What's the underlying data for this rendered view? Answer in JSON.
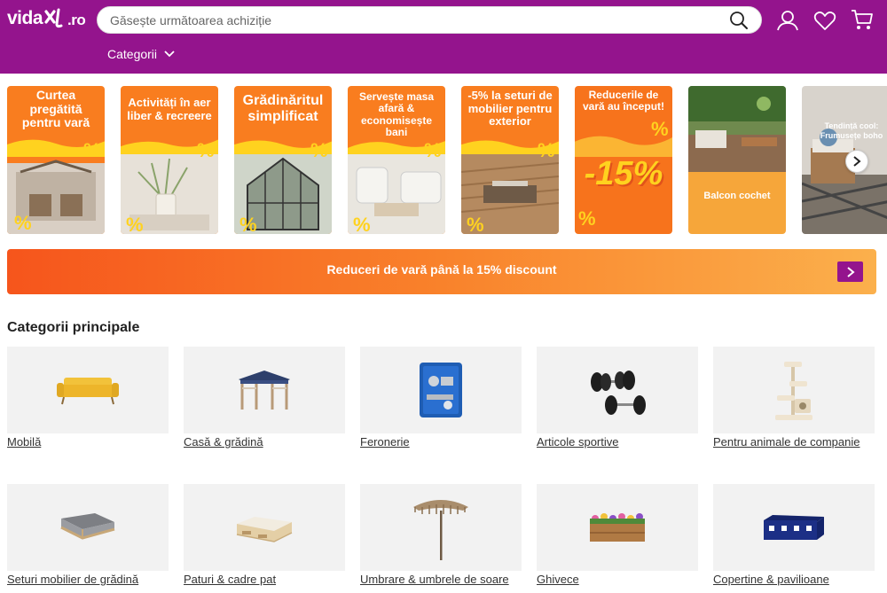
{
  "header": {
    "logo_left": "vida",
    "logo_right": ".ro",
    "search_placeholder": "Găsește următoarea achiziție",
    "categories_label": "Categorii",
    "bg_color": "#94148d"
  },
  "promos": [
    {
      "title": "Curtea pregătită pentru vară"
    },
    {
      "title": "Activități în aer liber & recreere"
    },
    {
      "title": "Grădinăritul simplificat"
    },
    {
      "title": "Servește masa afară & economisește bani"
    },
    {
      "title": "-5% la seturi de mobilier pentru exterior"
    },
    {
      "title": "Reducerile de vară au început!",
      "big": "-15%"
    },
    {
      "title": "Balcon cochet"
    },
    {
      "title": "Tendință cool: Frumusețe boho"
    }
  ],
  "banner": {
    "text": "Reduceri de vară până la 15% discount"
  },
  "section": {
    "title": "Categorii principale"
  },
  "categories": [
    {
      "label": "Mobilă",
      "icon": "sofa-icon"
    },
    {
      "label": "Casă & grădină",
      "icon": "gazebo-icon"
    },
    {
      "label": "Feronerie",
      "icon": "toolcase-icon"
    },
    {
      "label": "Articole sportive",
      "icon": "dumbbell-icon"
    },
    {
      "label": "Pentru animale de companie",
      "icon": "cat-tree-icon"
    },
    {
      "label": "Seturi mobilier de grădină",
      "icon": "lounge-set-icon"
    },
    {
      "label": "Paturi & cadre pat",
      "icon": "bed-icon"
    },
    {
      "label": "Umbrare & umbrele de soare",
      "icon": "umbrella-icon"
    },
    {
      "label": "Ghivece",
      "icon": "planter-icon"
    },
    {
      "label": "Copertine & pavilioane",
      "icon": "tent-icon"
    }
  ]
}
